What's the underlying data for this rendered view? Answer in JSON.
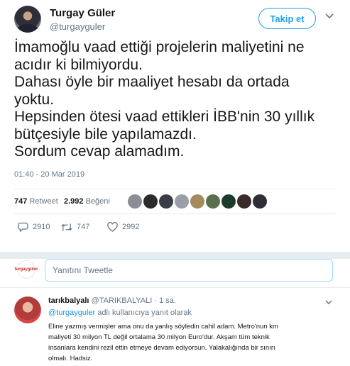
{
  "tweet": {
    "author_name": "Turgay Güler",
    "author_handle": "@turgayguler",
    "follow_label": "Takip et",
    "text_lines": [
      "İmamoğlu vaad ettiği projelerin maliyetini ne",
      "acıdır ki bilmiyordu.",
      "Dahası öyle bir maaliyet hesabı da ortada",
      "yoktu.",
      "Hepsinden ötesi vaad ettikleri İBB'nin 30 yıllık",
      "bütçesiyle bile yapılamazdı.",
      "Sordum cevap alamadım."
    ],
    "timestamp": "01:40 - 20 Mar 2019",
    "retweet_count": "747",
    "retweet_label": "Retweet",
    "like_count": "2.992",
    "like_label": "Beğeni",
    "likers": [
      {
        "color": "#8a8f96"
      },
      {
        "color": "#2b2b2b"
      },
      {
        "color": "#3a3d45"
      },
      {
        "color": "#9a9fa7"
      },
      {
        "color": "#a48a5c"
      },
      {
        "color": "#5b6e4f"
      },
      {
        "color": "#1d3b2c"
      },
      {
        "color": "#3b2a2a"
      },
      {
        "color": "#2e2e36"
      }
    ],
    "actions": {
      "reply_count": "2910",
      "retweet_count": "747",
      "like_count": "2992"
    }
  },
  "reply_box": {
    "avatar_text": "turgaygüler",
    "placeholder": "Yanıtını Tweetle"
  },
  "reply": {
    "author_name": "tarıkbalyalı",
    "author_handle": "@TARIKBALYALI",
    "time": "1 sa.",
    "reply_to_mention": "@turgayguler",
    "reply_to_suffix": "adlı kullanıcıya yanıt olarak",
    "text_lines": [
      "Eline yazmış vermişler ama onu da yanlış söyledin cahil adam. Metro'nun km",
      "maliyeti 30 milyon TL değil  ortalama 30 milyon Euro'dur. Akşam tüm teknik",
      "insanlara kendini rezil ettin etmeye devam ediyorsun. Yalakalığında bir sınırı",
      "olmalı. Hadsiz."
    ]
  },
  "colors": {
    "accent": "#1da1f2",
    "text": "#14171a",
    "muted": "#657786",
    "border": "#e6ecf0"
  }
}
